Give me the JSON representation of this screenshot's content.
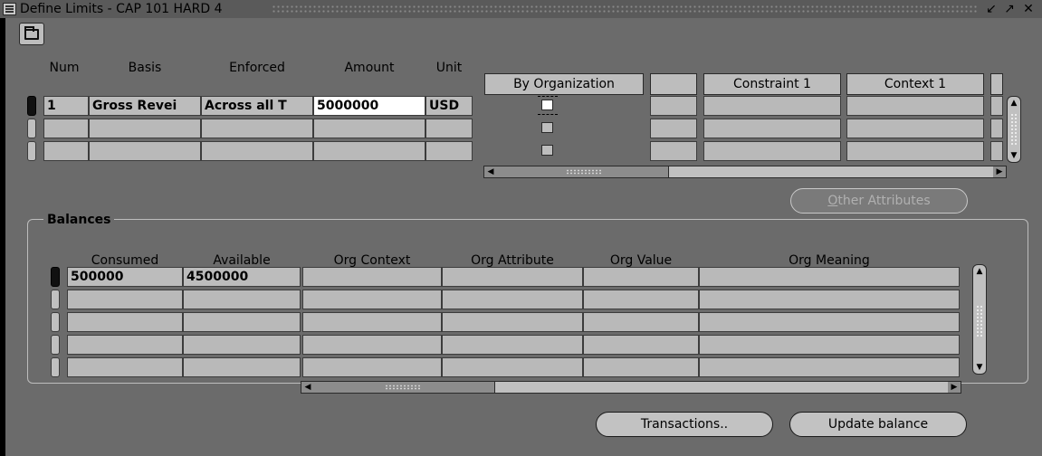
{
  "window": {
    "title": "Define Limits - CAP 101 HARD 4",
    "controls": [
      "minimize-icon",
      "maximize-icon",
      "close-icon"
    ]
  },
  "toolbar": {
    "open_folder_icon": "folder-open-icon"
  },
  "limits": {
    "headers": {
      "num": "Num",
      "basis": "Basis",
      "enforced": "Enforced",
      "amount": "Amount",
      "unit": "Unit",
      "by_organization": "By Organization",
      "constraint_1": "Constraint 1",
      "context_1": "Context 1"
    },
    "rows": [
      {
        "num": "1",
        "basis": "Gross Revei",
        "enforced": "Across all T",
        "amount": "5000000",
        "unit": "USD",
        "by_organization": true
      },
      {
        "num": "",
        "basis": "",
        "enforced": "",
        "amount": "",
        "unit": "",
        "by_organization": false
      },
      {
        "num": "",
        "basis": "",
        "enforced": "",
        "amount": "",
        "unit": "",
        "by_organization": false
      }
    ]
  },
  "other_attributes_button": "Other Attributes",
  "balances": {
    "label": "Balances",
    "headers": {
      "consumed": "Consumed",
      "available": "Available",
      "org_context": "Org Context",
      "org_attribute": "Org Attribute",
      "org_value": "Org Value",
      "org_meaning": "Org Meaning"
    },
    "rows": [
      {
        "consumed": "500000",
        "available": "4500000"
      },
      {
        "consumed": "",
        "available": ""
      },
      {
        "consumed": "",
        "available": ""
      },
      {
        "consumed": "",
        "available": ""
      },
      {
        "consumed": "",
        "available": ""
      }
    ]
  },
  "buttons": {
    "transactions": "Transactions..",
    "update_balance": "Update balance"
  }
}
